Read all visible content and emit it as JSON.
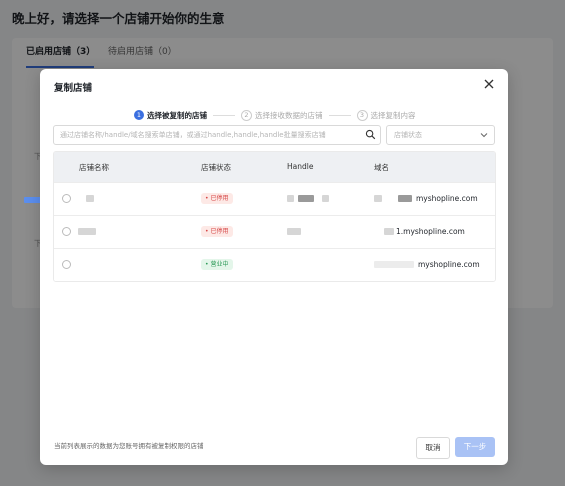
{
  "background": {
    "greeting": "晚上好，请选择一个店铺开始你的生意",
    "tabs": [
      {
        "label": "已启用店铺（3）"
      },
      {
        "label": "待启用店铺（0）"
      }
    ],
    "row_marks": [
      "下",
      "下"
    ]
  },
  "modal": {
    "title": "复制店铺",
    "close_icon": "close-icon",
    "steps": [
      {
        "num": "1",
        "label": "选择被复制的店铺"
      },
      {
        "num": "2",
        "label": "选择接收数据的店铺"
      },
      {
        "num": "3",
        "label": "选择复制内容"
      }
    ],
    "search": {
      "placeholder": "通过店铺名称/handle/域名搜索单店铺，或通过handle,handle,handle批量搜索店铺",
      "value": ""
    },
    "status_filter": {
      "placeholder": "店铺状态"
    },
    "table": {
      "columns": [
        "店铺名称",
        "店铺状态",
        "Handle",
        "域名"
      ],
      "rows": [
        {
          "status": "已停用",
          "status_type": "stopped",
          "domain": "myshopline.com"
        },
        {
          "status": "已停用",
          "status_type": "stopped",
          "domain": "1.myshopline.com"
        },
        {
          "status": "营业中",
          "status_type": "open",
          "domain": "myshopline.com"
        }
      ]
    },
    "footer_note": "当前列表展示的数据为您账号拥有被复制权限的店铺",
    "cancel_label": "取消",
    "next_label": "下一步"
  },
  "colors": {
    "accent": "#3b6fe0",
    "next_disabled": "#a9c2f5",
    "stopped": "#d64545",
    "open": "#2e9b59"
  }
}
